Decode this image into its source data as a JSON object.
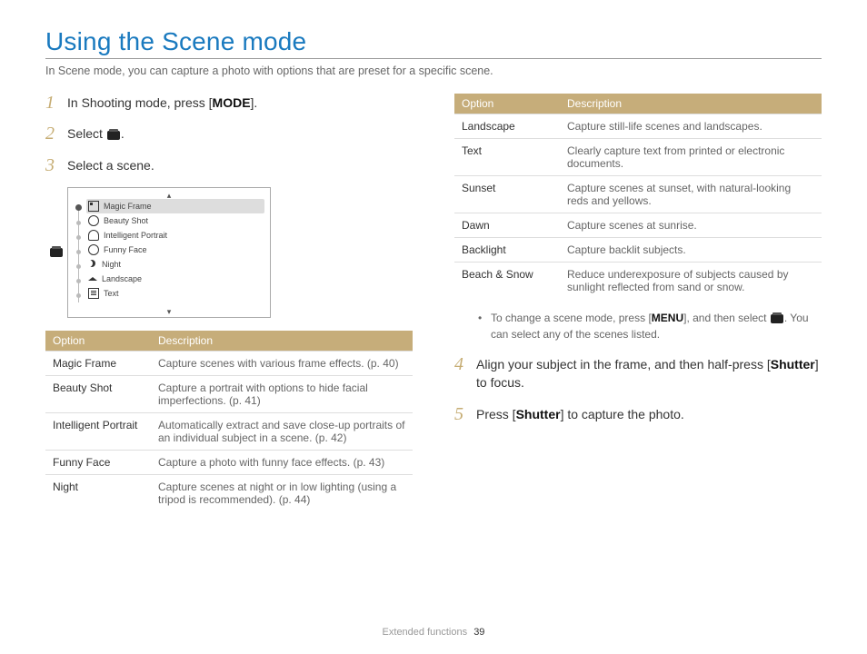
{
  "title": "Using the Scene mode",
  "intro": "In Scene mode, you can capture a photo with options that are preset for a specific scene.",
  "steps": {
    "s1_a": "In Shooting mode, press [",
    "s1_b": "MODE",
    "s1_c": "].",
    "s2": "Select ",
    "s2_end": ".",
    "s3": "Select a scene.",
    "s4_a": "Align your subject in the frame, and then half-press [",
    "s4_b": "Shutter",
    "s4_c": "] to focus.",
    "s5_a": "Press [",
    "s5_b": "Shutter",
    "s5_c": "] to capture the photo."
  },
  "mini_menu": {
    "items": [
      "Magic Frame",
      "Beauty Shot",
      "Intelligent Portrait",
      "Funny Face",
      "Night",
      "Landscape",
      "Text"
    ]
  },
  "table_header": {
    "option": "Option",
    "description": "Description"
  },
  "left_table": [
    {
      "name": "Magic Frame",
      "desc": "Capture scenes with various frame effects. (p. 40)"
    },
    {
      "name": "Beauty Shot",
      "desc": "Capture a portrait with options to hide facial imperfections. (p. 41)"
    },
    {
      "name": "Intelligent Portrait",
      "desc": "Automatically extract and save close-up portraits of an individual subject in a scene. (p. 42)"
    },
    {
      "name": "Funny Face",
      "desc": "Capture a photo with funny face effects. (p. 43)"
    },
    {
      "name": "Night",
      "desc": "Capture scenes at night or in low lighting (using a tripod is recommended). (p. 44)"
    }
  ],
  "right_table": [
    {
      "name": "Landscape",
      "desc": "Capture still-life scenes and landscapes."
    },
    {
      "name": "Text",
      "desc": "Clearly capture text from printed or electronic documents."
    },
    {
      "name": "Sunset",
      "desc": "Capture scenes at sunset, with natural-looking reds and yellows."
    },
    {
      "name": "Dawn",
      "desc": "Capture scenes at sunrise."
    },
    {
      "name": "Backlight",
      "desc": "Capture backlit subjects."
    },
    {
      "name": "Beach & Snow",
      "desc": "Reduce underexposure of subjects caused by sunlight reflected from sand or snow."
    }
  ],
  "note": {
    "a": "To change a scene mode, press [",
    "b": "MENU",
    "c": "], and then select ",
    "d": ". You can select any of the scenes listed."
  },
  "footer": {
    "section": "Extended functions",
    "page": "39"
  }
}
